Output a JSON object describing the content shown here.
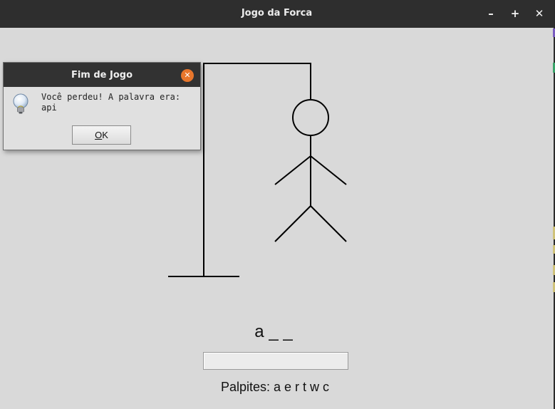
{
  "window": {
    "title": "Jogo da Forca",
    "minimize_glyph": "–",
    "maximize_glyph": "+",
    "close_glyph": "✕"
  },
  "game": {
    "word_display": "a _ _",
    "guess_input_value": "",
    "guesses_text": "Palpites: a e r t w c",
    "mistakes_drawn": 6,
    "max_mistakes": 6
  },
  "dialog": {
    "title": "Fim de Jogo",
    "message_line1": "Você perdeu! A palavra era:",
    "message_line2": "api",
    "ok_label": "OK",
    "ok_mnemonic": "O",
    "icon": "lightbulb-info-icon"
  },
  "colors": {
    "background": "#d9d9d9",
    "titlebar": "#2e2e2e",
    "dialog_close": "#e8762c",
    "drawing": "#000000"
  }
}
